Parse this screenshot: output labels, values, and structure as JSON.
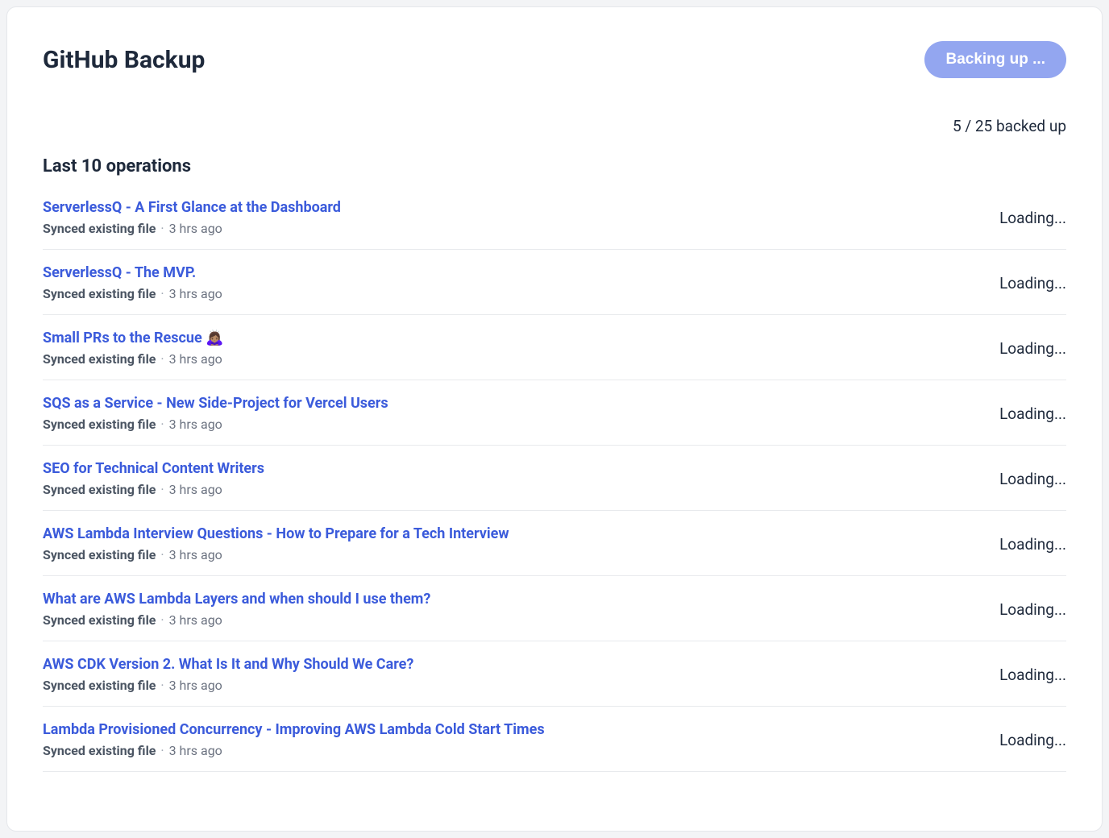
{
  "header": {
    "title": "GitHub Backup",
    "button_label": "Backing up ..."
  },
  "status": {
    "text": "5 / 25 backed up"
  },
  "section": {
    "title": "Last 10 operations"
  },
  "operations": [
    {
      "title": "ServerlessQ - A First Glance at the Dashboard",
      "action": "Synced existing file",
      "time": "3 hrs ago",
      "status": "Loading..."
    },
    {
      "title": "ServerlessQ - The MVP.",
      "action": "Synced existing file",
      "time": "3 hrs ago",
      "status": "Loading..."
    },
    {
      "title": "Small PRs to the Rescue 🙇🏽‍♀️",
      "action": "Synced existing file",
      "time": "3 hrs ago",
      "status": "Loading..."
    },
    {
      "title": "SQS as a Service - New Side-Project for Vercel Users",
      "action": "Synced existing file",
      "time": "3 hrs ago",
      "status": "Loading..."
    },
    {
      "title": "SEO for Technical Content Writers",
      "action": "Synced existing file",
      "time": "3 hrs ago",
      "status": "Loading..."
    },
    {
      "title": "AWS Lambda Interview Questions - How to Prepare for a Tech Interview",
      "action": "Synced existing file",
      "time": "3 hrs ago",
      "status": "Loading..."
    },
    {
      "title": "What are AWS Lambda Layers and when should I use them?",
      "action": "Synced existing file",
      "time": "3 hrs ago",
      "status": "Loading..."
    },
    {
      "title": "AWS CDK Version 2. What Is It and Why Should We Care?",
      "action": "Synced existing file",
      "time": "3 hrs ago",
      "status": "Loading..."
    },
    {
      "title": "Lambda Provisioned Concurrency - Improving AWS Lambda Cold Start Times",
      "action": "Synced existing file",
      "time": "3 hrs ago",
      "status": "Loading..."
    }
  ],
  "separator": "·"
}
